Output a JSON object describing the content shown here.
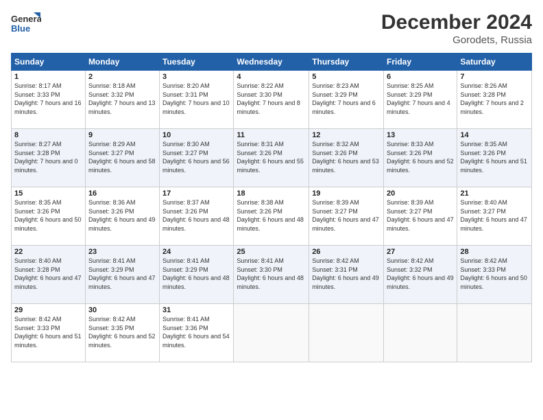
{
  "header": {
    "logo_line1": "General",
    "logo_line2": "Blue",
    "title": "December 2024",
    "subtitle": "Gorodets, Russia"
  },
  "days_of_week": [
    "Sunday",
    "Monday",
    "Tuesday",
    "Wednesday",
    "Thursday",
    "Friday",
    "Saturday"
  ],
  "weeks": [
    [
      {
        "day": "1",
        "sunrise": "8:17 AM",
        "sunset": "3:33 PM",
        "daylight": "7 hours and 16 minutes."
      },
      {
        "day": "2",
        "sunrise": "8:18 AM",
        "sunset": "3:32 PM",
        "daylight": "7 hours and 13 minutes."
      },
      {
        "day": "3",
        "sunrise": "8:20 AM",
        "sunset": "3:31 PM",
        "daylight": "7 hours and 10 minutes."
      },
      {
        "day": "4",
        "sunrise": "8:22 AM",
        "sunset": "3:30 PM",
        "daylight": "7 hours and 8 minutes."
      },
      {
        "day": "5",
        "sunrise": "8:23 AM",
        "sunset": "3:29 PM",
        "daylight": "7 hours and 6 minutes."
      },
      {
        "day": "6",
        "sunrise": "8:25 AM",
        "sunset": "3:29 PM",
        "daylight": "7 hours and 4 minutes."
      },
      {
        "day": "7",
        "sunrise": "8:26 AM",
        "sunset": "3:28 PM",
        "daylight": "7 hours and 2 minutes."
      }
    ],
    [
      {
        "day": "8",
        "sunrise": "8:27 AM",
        "sunset": "3:28 PM",
        "daylight": "7 hours and 0 minutes."
      },
      {
        "day": "9",
        "sunrise": "8:29 AM",
        "sunset": "3:27 PM",
        "daylight": "6 hours and 58 minutes."
      },
      {
        "day": "10",
        "sunrise": "8:30 AM",
        "sunset": "3:27 PM",
        "daylight": "6 hours and 56 minutes."
      },
      {
        "day": "11",
        "sunrise": "8:31 AM",
        "sunset": "3:26 PM",
        "daylight": "6 hours and 55 minutes."
      },
      {
        "day": "12",
        "sunrise": "8:32 AM",
        "sunset": "3:26 PM",
        "daylight": "6 hours and 53 minutes."
      },
      {
        "day": "13",
        "sunrise": "8:33 AM",
        "sunset": "3:26 PM",
        "daylight": "6 hours and 52 minutes."
      },
      {
        "day": "14",
        "sunrise": "8:35 AM",
        "sunset": "3:26 PM",
        "daylight": "6 hours and 51 minutes."
      }
    ],
    [
      {
        "day": "15",
        "sunrise": "8:35 AM",
        "sunset": "3:26 PM",
        "daylight": "6 hours and 50 minutes."
      },
      {
        "day": "16",
        "sunrise": "8:36 AM",
        "sunset": "3:26 PM",
        "daylight": "6 hours and 49 minutes."
      },
      {
        "day": "17",
        "sunrise": "8:37 AM",
        "sunset": "3:26 PM",
        "daylight": "6 hours and 48 minutes."
      },
      {
        "day": "18",
        "sunrise": "8:38 AM",
        "sunset": "3:26 PM",
        "daylight": "6 hours and 48 minutes."
      },
      {
        "day": "19",
        "sunrise": "8:39 AM",
        "sunset": "3:27 PM",
        "daylight": "6 hours and 47 minutes."
      },
      {
        "day": "20",
        "sunrise": "8:39 AM",
        "sunset": "3:27 PM",
        "daylight": "6 hours and 47 minutes."
      },
      {
        "day": "21",
        "sunrise": "8:40 AM",
        "sunset": "3:27 PM",
        "daylight": "6 hours and 47 minutes."
      }
    ],
    [
      {
        "day": "22",
        "sunrise": "8:40 AM",
        "sunset": "3:28 PM",
        "daylight": "6 hours and 47 minutes."
      },
      {
        "day": "23",
        "sunrise": "8:41 AM",
        "sunset": "3:29 PM",
        "daylight": "6 hours and 47 minutes."
      },
      {
        "day": "24",
        "sunrise": "8:41 AM",
        "sunset": "3:29 PM",
        "daylight": "6 hours and 48 minutes."
      },
      {
        "day": "25",
        "sunrise": "8:41 AM",
        "sunset": "3:30 PM",
        "daylight": "6 hours and 48 minutes."
      },
      {
        "day": "26",
        "sunrise": "8:42 AM",
        "sunset": "3:31 PM",
        "daylight": "6 hours and 49 minutes."
      },
      {
        "day": "27",
        "sunrise": "8:42 AM",
        "sunset": "3:32 PM",
        "daylight": "6 hours and 49 minutes."
      },
      {
        "day": "28",
        "sunrise": "8:42 AM",
        "sunset": "3:33 PM",
        "daylight": "6 hours and 50 minutes."
      }
    ],
    [
      {
        "day": "29",
        "sunrise": "8:42 AM",
        "sunset": "3:33 PM",
        "daylight": "6 hours and 51 minutes."
      },
      {
        "day": "30",
        "sunrise": "8:42 AM",
        "sunset": "3:35 PM",
        "daylight": "6 hours and 52 minutes."
      },
      {
        "day": "31",
        "sunrise": "8:41 AM",
        "sunset": "3:36 PM",
        "daylight": "6 hours and 54 minutes."
      },
      null,
      null,
      null,
      null
    ]
  ]
}
